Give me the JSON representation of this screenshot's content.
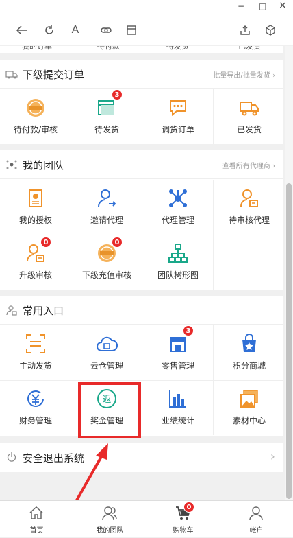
{
  "window": {
    "minimize": "−",
    "maximize": "□",
    "close": "×"
  },
  "toolbar": {
    "back_icon": "back-arrow-icon",
    "reload_icon": "reload-icon",
    "text_size": "A",
    "link_icon": "link-icon",
    "panel_icon": "panel-icon",
    "share_icon": "share-icon",
    "cube_icon": "cube-icon"
  },
  "clipped_labels": [
    "我的订单",
    "待付款",
    "待发货",
    "已发货"
  ],
  "sub_orders": {
    "title": "下级提交订单",
    "link": "批量导出/批量发货",
    "items": [
      {
        "label": "待付款/审核",
        "icon": "pay-seal-icon"
      },
      {
        "label": "待发货",
        "icon": "box-icon",
        "badge": "3"
      },
      {
        "label": "调货订单",
        "icon": "chat-icon"
      },
      {
        "label": "已发货",
        "icon": "truck-icon"
      }
    ]
  },
  "team": {
    "title": "我的团队",
    "link": "查看所有代理商",
    "items": [
      {
        "label": "我的授权",
        "icon": "certificate-icon"
      },
      {
        "label": "邀请代理",
        "icon": "invite-user-icon"
      },
      {
        "label": "代理管理",
        "icon": "network-icon"
      },
      {
        "label": "待审核代理",
        "icon": "pending-user-icon"
      },
      {
        "label": "升级审核",
        "icon": "upgrade-user-icon",
        "badge": "0"
      },
      {
        "label": "下级充值审核",
        "icon": "recharge-seal-icon",
        "badge": "0"
      },
      {
        "label": "团队树形图",
        "icon": "tree-icon"
      }
    ]
  },
  "common": {
    "title": "常用入口",
    "items": [
      {
        "label": "主动发货",
        "icon": "scan-ship-icon"
      },
      {
        "label": "云仓管理",
        "icon": "cloud-warehouse-icon"
      },
      {
        "label": "零售管理",
        "icon": "store-icon",
        "badge": "3"
      },
      {
        "label": "积分商城",
        "icon": "points-bag-icon"
      },
      {
        "label": "财务管理",
        "icon": "finance-icon"
      },
      {
        "label": "奖金管理",
        "icon": "bonus-icon"
      },
      {
        "label": "业绩统计",
        "icon": "bar-chart-icon"
      },
      {
        "label": "素材中心",
        "icon": "images-icon"
      }
    ]
  },
  "logout": {
    "label": "安全退出系统"
  },
  "tabs": [
    {
      "label": "首页",
      "icon": "home-icon"
    },
    {
      "label": "我的团队",
      "icon": "team-icon"
    },
    {
      "label": "购物车",
      "icon": "cart-icon",
      "badge": "0"
    },
    {
      "label": "帐户",
      "icon": "account-icon"
    }
  ],
  "colors": {
    "accent_orange": "#f0932b",
    "accent_blue": "#2f6fd6",
    "accent_green": "#1aa88a",
    "badge_red": "#e82a2a",
    "highlight_red": "#e82a2a"
  }
}
